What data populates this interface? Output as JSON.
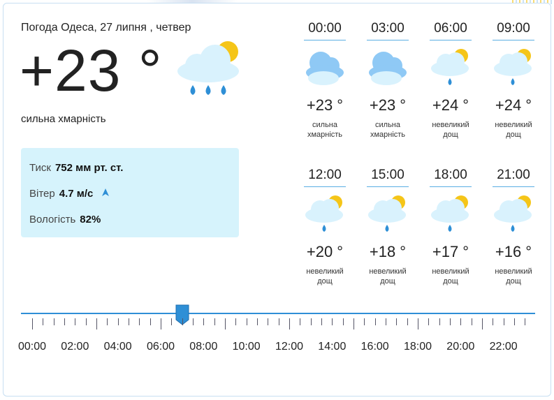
{
  "header": {
    "title": "Погода Одеса, 27 липня , четвер"
  },
  "current": {
    "temperature": "+23 °",
    "condition": "сильна хмарність",
    "icon": "cloud-sun-rain-icon"
  },
  "details": {
    "pressure_label": "Тиск",
    "pressure_value": "752 мм рт. ст.",
    "wind_label": "Вітер",
    "wind_value": "4.7 м/с",
    "humidity_label": "Вологість",
    "humidity_value": "82%"
  },
  "hours": [
    {
      "time": "00:00",
      "temp": "+23 °",
      "cond": "сильна хмарність",
      "icon": "cloud-icon"
    },
    {
      "time": "03:00",
      "temp": "+23 °",
      "cond": "сильна хмарність",
      "icon": "cloud-icon"
    },
    {
      "time": "06:00",
      "temp": "+24 °",
      "cond": "невеликий дощ",
      "icon": "cloud-sun-rain-icon"
    },
    {
      "time": "09:00",
      "temp": "+24 °",
      "cond": "невеликий дощ",
      "icon": "cloud-sun-rain-icon"
    },
    {
      "time": "12:00",
      "temp": "+20 °",
      "cond": "невеликий дощ",
      "icon": "cloud-sun-rain-icon"
    },
    {
      "time": "15:00",
      "temp": "+18 °",
      "cond": "невеликий дощ",
      "icon": "cloud-sun-rain-icon"
    },
    {
      "time": "18:00",
      "temp": "+17 °",
      "cond": "невеликий дощ",
      "icon": "cloud-sun-rain-icon"
    },
    {
      "time": "21:00",
      "temp": "+16 °",
      "cond": "невеликий дощ",
      "icon": "cloud-sun-rain-icon"
    }
  ],
  "timeline": {
    "labels": [
      "00:00",
      "02:00",
      "04:00",
      "06:00",
      "08:00",
      "10:00",
      "12:00",
      "14:00",
      "16:00",
      "18:00",
      "20:00",
      "22:00"
    ],
    "selected_hour": 7
  },
  "colors": {
    "accent": "#2e8fd6",
    "panel": "#d6f3fc",
    "sun": "#f5c518",
    "cloud": "#d9f2fd",
    "cloud_dark": "#8fc9f5",
    "drop": "#2e8fd6"
  }
}
